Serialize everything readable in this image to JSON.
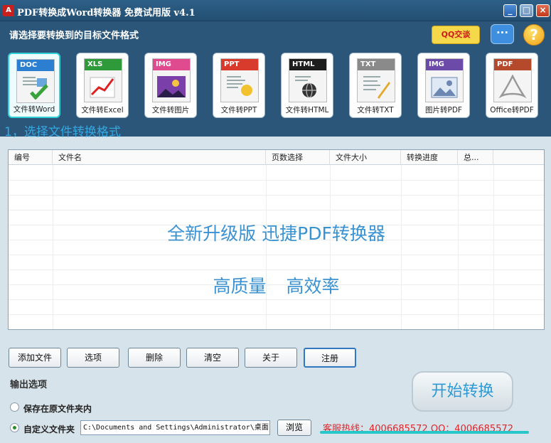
{
  "window": {
    "title": "PDF转换成Word转换器 免费试用版 v4.1",
    "min_glyph": "_",
    "max_glyph": "□",
    "close_glyph": "×"
  },
  "header": {
    "prompt": "请选择要转换到的目标文件格式",
    "qq_chat": "QQ交谈",
    "msg_glyph": "···",
    "help_glyph": "?",
    "formats": [
      {
        "tag": "DOC",
        "label": "文件转Word",
        "color": "#2c7fd0",
        "selected": true
      },
      {
        "tag": "XLS",
        "label": "文件转Excel",
        "color": "#2f9a3a"
      },
      {
        "tag": "IMG",
        "label": "文件转图片",
        "color": "#e04a8e"
      },
      {
        "tag": "PPT",
        "label": "文件转PPT",
        "color": "#d83b2b"
      },
      {
        "tag": "HTML",
        "label": "文件转HTML",
        "color": "#1d1d1d"
      },
      {
        "tag": "TXT",
        "label": "文件转TXT",
        "color": "#8a8a8a"
      },
      {
        "tag": "IMG",
        "label": "图片转PDF",
        "color": "#6b4aa8"
      },
      {
        "tag": "PDF",
        "label": "Office转PDF",
        "color": "#b5492b"
      }
    ],
    "step_label": "1，选择文件转换格式"
  },
  "filelist": {
    "columns": [
      "编号",
      "文件名",
      "页数选择",
      "文件大小",
      "转换进度",
      "总..."
    ],
    "promo_line1": "全新升级版 迅捷PDF转换器",
    "promo_line2": "高质量 高效率"
  },
  "actions": [
    "添加文件",
    "选项",
    "删除",
    "清空",
    "关于",
    "注册"
  ],
  "output": {
    "title": "输出选项",
    "option_original": "保存在原文件夹内",
    "option_custom": "自定义文件夹",
    "custom_path": "C:\\Documents and Settings\\Administrator\\桌面",
    "browse": "浏览",
    "selected": "custom"
  },
  "start_button": "开始转换",
  "hotline": "客服热线：4006685572 QQ：4006685572"
}
